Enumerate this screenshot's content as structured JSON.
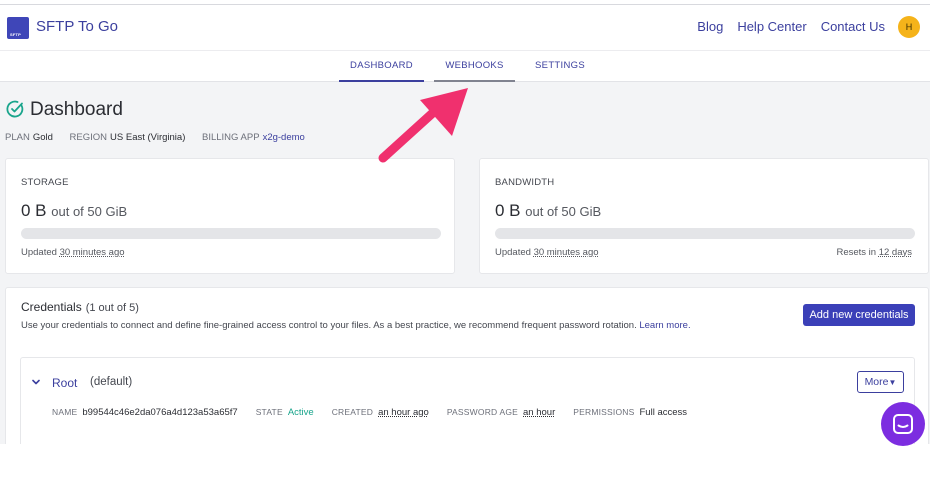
{
  "brand": {
    "name": "SFTP To Go",
    "logo_text": "SFTP"
  },
  "top_nav": {
    "blog": "Blog",
    "help": "Help Center",
    "contact": "Contact Us",
    "avatar_initial": "H"
  },
  "tabs": [
    {
      "label": "DASHBOARD",
      "state": "active"
    },
    {
      "label": "WEBHOOKS",
      "state": "hover"
    },
    {
      "label": "SETTINGS",
      "state": "normal"
    }
  ],
  "page": {
    "title": "Dashboard",
    "plan_key": "PLAN",
    "plan": "Gold",
    "region_key": "REGION",
    "region": "US East (Virginia)",
    "billing_key": "BILLING APP",
    "billing": "x2g-demo"
  },
  "storage": {
    "label": "STORAGE",
    "used": "0 B",
    "of": "out of 50 GiB",
    "updated_prefix": "Updated",
    "updated": "30 minutes ago",
    "usage_fraction": 0
  },
  "bandwidth": {
    "label": "BANDWIDTH",
    "used": "0 B",
    "of": "out of 50 GiB",
    "updated_prefix": "Updated",
    "updated": "30 minutes ago",
    "reset_prefix": "Resets in",
    "reset": "12 days",
    "usage_fraction": 0
  },
  "credentials": {
    "title": "Credentials",
    "count": "(1 out of 5)",
    "description": "Use your credentials to connect and define fine-grained access control to your files. As a best practice, we recommend frequent password rotation.",
    "learn_more": "Learn more.",
    "add_button": "Add new credentials",
    "root": {
      "name": "Root",
      "tag": "(default)",
      "more_button": "More",
      "name_key": "NAME",
      "name_value": "b99544c46e2da076a4d123a53a65f7",
      "state_key": "STATE",
      "state_value": "Active",
      "created_key": "CREATED",
      "created_value": "an hour ago",
      "pwage_key": "PASSWORD AGE",
      "pwage_value": "an hour",
      "perm_key": "PERMISSIONS",
      "perm_value": "Full access"
    }
  },
  "colors": {
    "accent": "#3b3f9e",
    "button": "#3b40b8",
    "active_state": "#1aa58c",
    "annotation_arrow": "#f0306e",
    "chat": "#7c2de0",
    "avatar": "#f5b31a"
  },
  "icons": {
    "dashboard": "gauge-check-icon",
    "expand": "chevron-down-icon",
    "dropdown": "caret-down-icon",
    "chat": "chat-bubble-icon"
  }
}
